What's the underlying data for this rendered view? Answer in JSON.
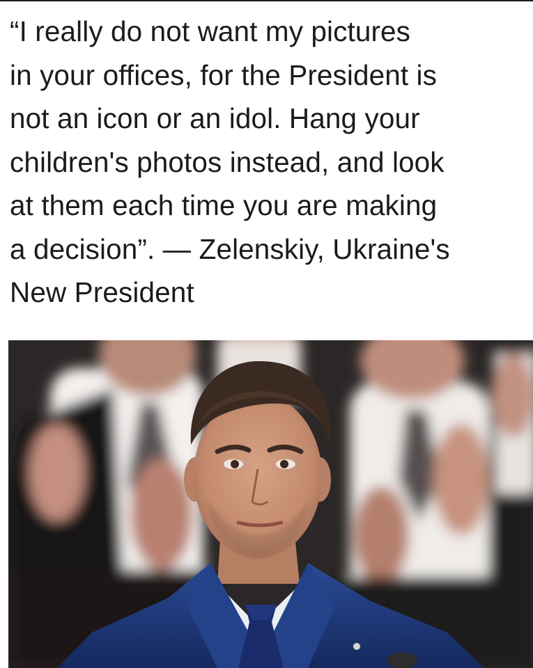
{
  "quote": {
    "lines": [
      "“I really do not want my pictures",
      "in your offices, for the President is",
      "not an icon or an idol. Hang your",
      "children's photos instead, and look",
      "at them each time you are making",
      "a decision”. — Zelenskiy, Ukraine's",
      "New President"
    ]
  },
  "photo": {
    "subject": "man-in-navy-suit-portrait",
    "background": "blurred-applauding-choir",
    "colors": {
      "suit": "#1f3a7a",
      "tie": "#1a2c6b",
      "shirt": "#e9eef3",
      "skin": "#c48f74",
      "hair": "#3a2a22",
      "robes": "#f2efec"
    }
  }
}
